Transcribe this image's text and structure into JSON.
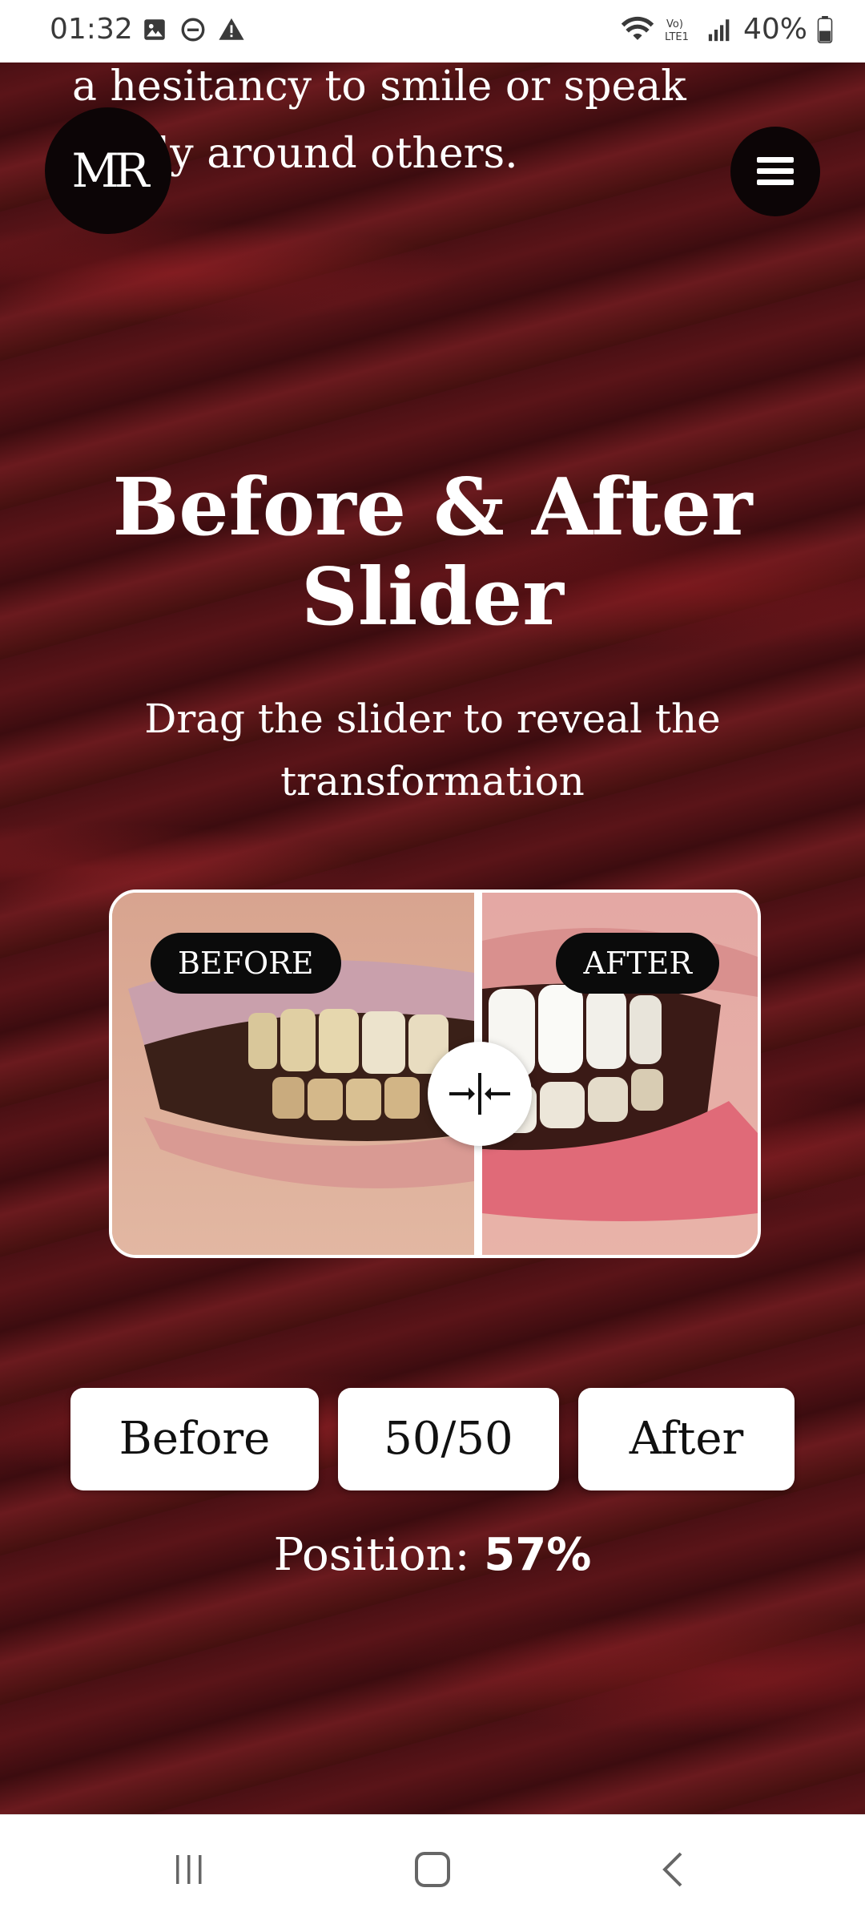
{
  "status_bar": {
    "time": "01:32",
    "battery": "40%",
    "icons_left": [
      "image-icon",
      "dnd-icon",
      "warning-icon"
    ],
    "icons_right": [
      "wifi-icon",
      "volte-icon",
      "signal-icon",
      "battery-icon"
    ]
  },
  "intro": {
    "line1": "a hesitancy to smile or speak",
    "line2": "freely around others."
  },
  "header": {
    "logo_text": "MR",
    "menu_icon": "hamburger-icon"
  },
  "hero": {
    "title": "Before & After Slider",
    "subtitle": "Drag the slider to reveal the transformation"
  },
  "comparison": {
    "before_label": "BEFORE",
    "after_label": "AFTER",
    "handle_icon": "compare-arrows-icon"
  },
  "controls": {
    "before_button": "Before",
    "fifty_button": "50/50",
    "after_button": "After"
  },
  "position": {
    "label": "Position:",
    "value": "57%",
    "fraction": 0.57
  },
  "colors": {
    "background": "#4a1014",
    "accent": "#0c0506",
    "button_bg": "#ffffff"
  }
}
